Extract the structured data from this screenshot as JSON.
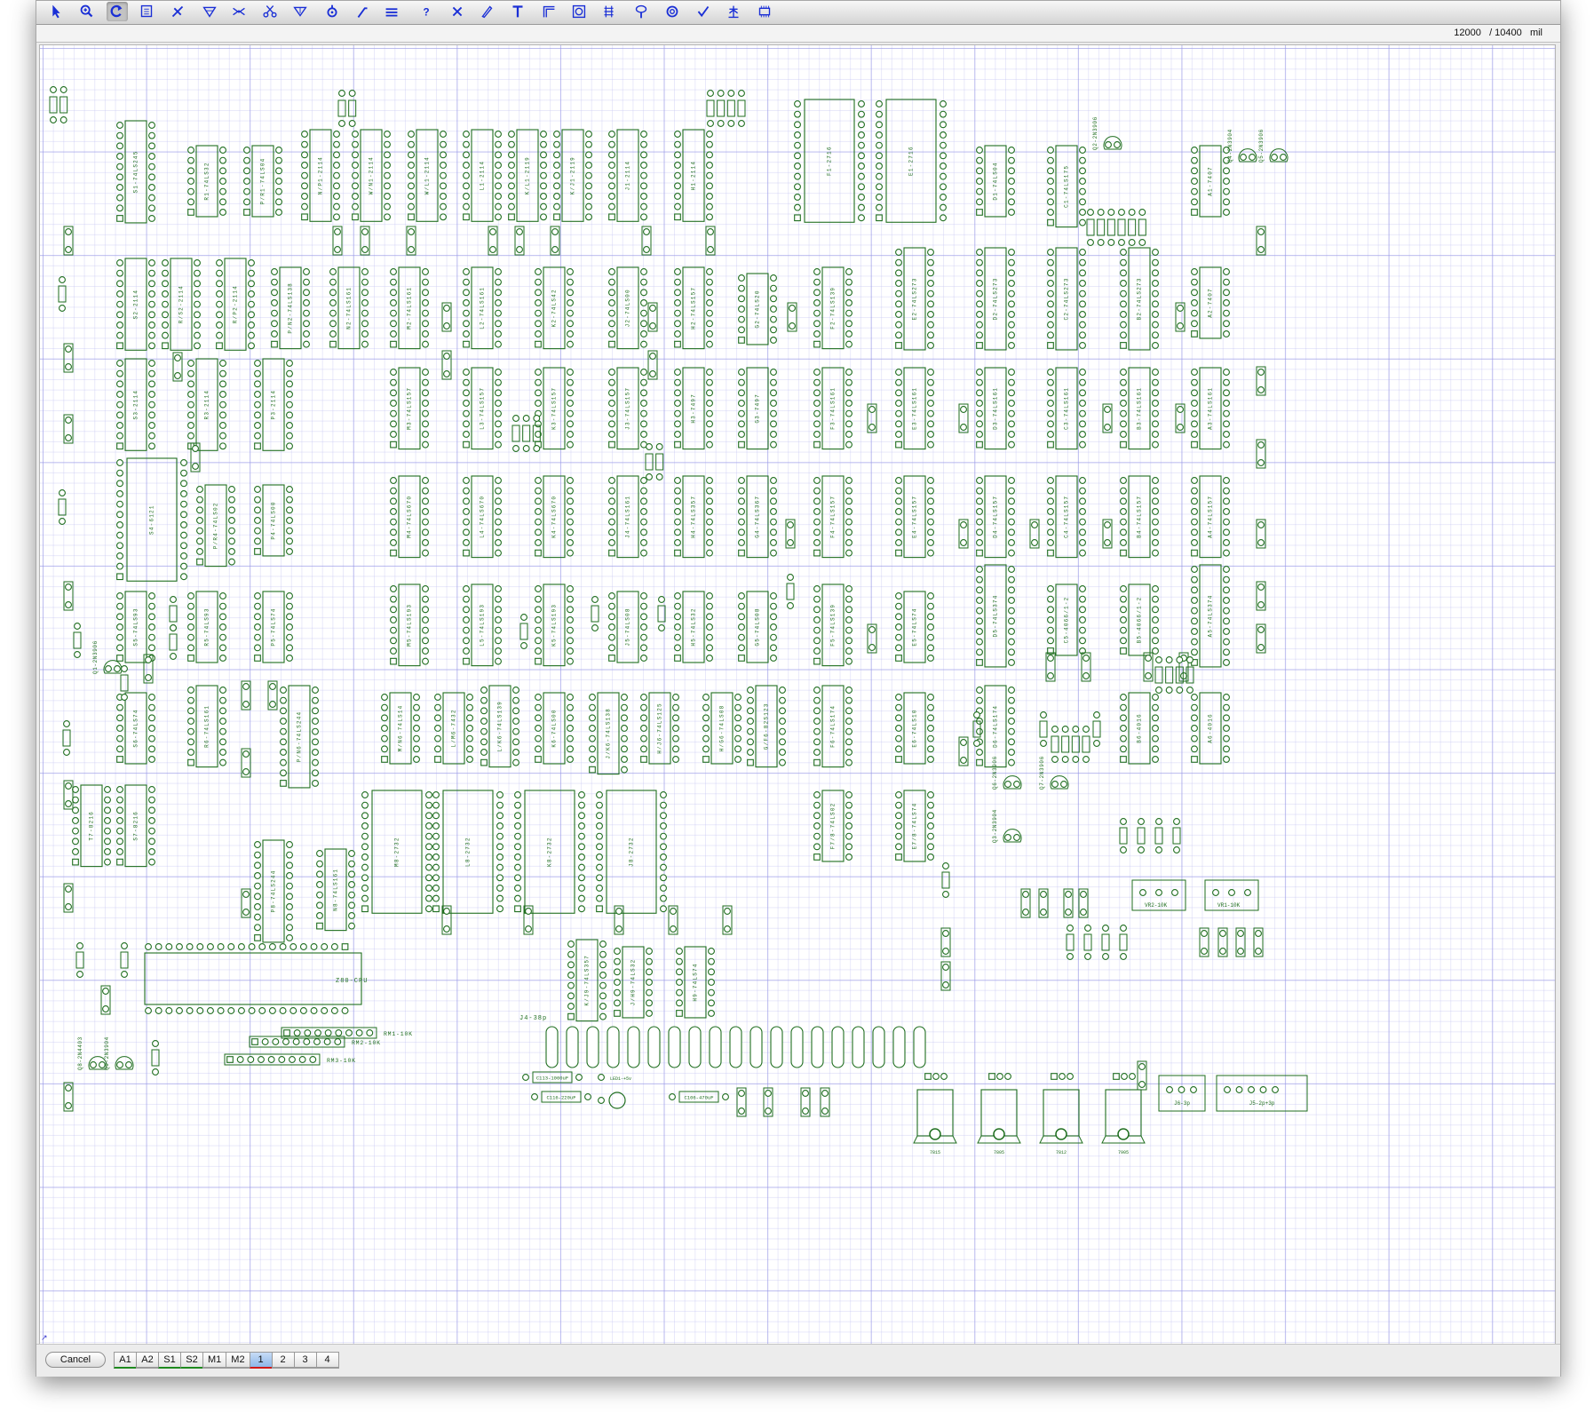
{
  "toolbar": {
    "tools": [
      {
        "name": "pointer-icon",
        "active": false
      },
      {
        "name": "zoom-icon",
        "active": false
      },
      {
        "name": "rotate-icon",
        "active": true
      },
      {
        "name": "place-part-icon",
        "active": false
      },
      {
        "name": "wire-icon",
        "active": false
      },
      {
        "name": "ground-icon",
        "active": false
      },
      {
        "name": "route-icon",
        "active": false
      },
      {
        "name": "cut-icon",
        "active": false
      },
      {
        "name": "down-arrow-icon",
        "active": false
      },
      {
        "name": "via-icon",
        "active": false
      },
      {
        "name": "angle-icon",
        "active": false
      },
      {
        "name": "bus-icon",
        "active": false
      },
      {
        "name": "help-icon",
        "active": false
      },
      {
        "name": "delete-icon",
        "active": false
      },
      {
        "name": "pencil-icon",
        "active": false
      },
      {
        "name": "text-icon",
        "active": false
      },
      {
        "name": "corner-icon",
        "active": false
      },
      {
        "name": "target-icon",
        "active": false
      },
      {
        "name": "align-icon",
        "active": false
      },
      {
        "name": "probe-icon",
        "active": false
      },
      {
        "name": "ring-icon",
        "active": false
      },
      {
        "name": "check-icon",
        "active": false
      },
      {
        "name": "anchor-icon",
        "active": false
      },
      {
        "name": "chip-icon",
        "active": false
      }
    ],
    "accent": "#1a2fd6"
  },
  "coord": {
    "x": "12000",
    "y": "/ 10400",
    "unit": "mil"
  },
  "board": {
    "trace_color": "#1f6e1f",
    "grid_color": "#9a9ae6",
    "chips": [
      [
        "S1-74LS245",
        20
      ],
      [
        "R1-74LS32",
        14
      ],
      [
        "P/R1-74LS04",
        14
      ],
      [
        "N/P1-2114",
        18
      ],
      [
        "W/N1-2114",
        18
      ],
      [
        "W/L1-2114",
        18
      ],
      [
        "L1-2114",
        18
      ],
      [
        "K/L1-2119",
        18
      ],
      [
        "K/J1-2119",
        18
      ],
      [
        "J1-2114",
        18
      ],
      [
        "H1-2114",
        18
      ],
      [
        "F1-2716",
        24
      ],
      [
        "E1-2716",
        24
      ],
      [
        "D1-74LS04",
        14
      ],
      [
        "C1-74LS175",
        16
      ],
      [
        "A1-7407",
        14
      ],
      [
        "S2-2114",
        18
      ],
      [
        "R/S2-2114",
        18
      ],
      [
        "R/P2-2114",
        18
      ],
      [
        "P/N2-74LS138",
        16
      ],
      [
        "N2-74LS161",
        16
      ],
      [
        "M2-74LS161",
        16
      ],
      [
        "L2-74LS161",
        16
      ],
      [
        "K2-74LS42",
        16
      ],
      [
        "J2-74LS00",
        16
      ],
      [
        "H2-74LS157",
        16
      ],
      [
        "G2-74LS20",
        14
      ],
      [
        "F2-74LS139",
        16
      ],
      [
        "E2-74LS273",
        20
      ],
      [
        "D2-74LS273",
        20
      ],
      [
        "C2-74LS273",
        20
      ],
      [
        "B2-74LS273",
        20
      ],
      [
        "A2-7407",
        14
      ],
      [
        "S3-2114",
        18
      ],
      [
        "R3-2114",
        18
      ],
      [
        "P3-2114",
        18
      ],
      [
        "M3-74LS157",
        16
      ],
      [
        "L3-74LS157",
        16
      ],
      [
        "K3-74LS157",
        16
      ],
      [
        "J3-74LS157",
        16
      ],
      [
        "H3-7497",
        16
      ],
      [
        "G3-7497",
        16
      ],
      [
        "F3-74LS161",
        16
      ],
      [
        "E3-74LS161",
        16
      ],
      [
        "D3-74LS161",
        16
      ],
      [
        "C3-74LS161",
        16
      ],
      [
        "B3-74LS161",
        16
      ],
      [
        "A3-74LS161",
        16
      ],
      [
        "S4-6121",
        24
      ],
      [
        "P/R4-74LS02",
        16
      ],
      [
        "P4-74LS00",
        14
      ],
      [
        "M4-74LS670",
        16
      ],
      [
        "L4-74LS670",
        16
      ],
      [
        "K4-74LS670",
        16
      ],
      [
        "J4-74LS161",
        16
      ],
      [
        "H4-74LS357",
        16
      ],
      [
        "G4-74LS367",
        16
      ],
      [
        "F4-74LS157",
        16
      ],
      [
        "E4-74LS157",
        16
      ],
      [
        "D4-74LS157",
        16
      ],
      [
        "C4-74LS157",
        16
      ],
      [
        "B4-74LS157",
        16
      ],
      [
        "A4-74LS157",
        16
      ],
      [
        "S5-74LS93",
        14
      ],
      [
        "R5-74LS93",
        14
      ],
      [
        "P5-74LS74",
        14
      ],
      [
        "M5-74LS193",
        16
      ],
      [
        "L5-74LS193",
        16
      ],
      [
        "K5-74LS193",
        16
      ],
      [
        "J5-74LS08",
        14
      ],
      [
        "H5-74LS32",
        14
      ],
      [
        "G5-74LS08",
        14
      ],
      [
        "F5-74LS139",
        16
      ],
      [
        "E5-74LS74",
        14
      ],
      [
        "D5-74LS374",
        20
      ],
      [
        "C5-4066/1-2",
        14
      ],
      [
        "B5-4066/1-2",
        14
      ],
      [
        "A5-74LS374",
        20
      ],
      [
        "S6-74LS74",
        14
      ],
      [
        "R6-74LS161",
        16
      ],
      [
        "P/N6-74LS244",
        20
      ],
      [
        "M/N6-74LS14",
        14
      ],
      [
        "L/M6-7432",
        14
      ],
      [
        "L/K6-74LS139",
        16
      ],
      [
        "K6-74LS00",
        14
      ],
      [
        "J/K6-74LS138",
        16
      ],
      [
        "H/J6-74LS125",
        14
      ],
      [
        "H/G6-74LS08",
        14
      ],
      [
        "G/F6-82S123",
        16
      ],
      [
        "F6-74LS174",
        16
      ],
      [
        "E6-74LS10",
        14
      ],
      [
        "D6-74LS174",
        16
      ],
      [
        "B6-4016",
        14
      ],
      [
        "A6-4016",
        14
      ],
      [
        "T7-8216",
        16
      ],
      [
        "S7-8216",
        16
      ],
      [
        "M8-2732",
        24
      ],
      [
        "L8-2732",
        24
      ],
      [
        "K8-2732",
        24
      ],
      [
        "J8-2732",
        24
      ],
      [
        "F7/8-74LS02",
        14
      ],
      [
        "E7/8-74LS74",
        14
      ],
      [
        "P8-74LS244",
        20
      ],
      [
        "N8-74LS161",
        16
      ],
      [
        "K/J9-74LS357",
        16
      ],
      [
        "J/H9-74LS32",
        14
      ],
      [
        "H9-74LS74",
        14
      ]
    ],
    "misc_labels": [
      "Z80-CPU",
      "J4-38p",
      "RM1-10K",
      "RM2-10K",
      "RM3-10K",
      "VR2-10K",
      "VR1-10K",
      "J6-3p",
      "J5-2p+3p",
      "C113-1000uF",
      "C116-220uF",
      "C106-470uF",
      "LED1-+5v"
    ],
    "transistor_labels": [
      "Q1-2N3906",
      "Q2-2N3906",
      "Q3-2N3904",
      "Q4-2N3904",
      "Q5-2N3906",
      "Q6-2N3906",
      "Q7-2N3906",
      "Q8-2N4403",
      "Q9-2N3904"
    ],
    "regulators": [
      "7815",
      "7805",
      "7812",
      "7905"
    ]
  },
  "status": {
    "cancel_label": "Cancel",
    "tabs": [
      {
        "label": "A1",
        "selected": false
      },
      {
        "label": "A2",
        "selected": false
      },
      {
        "label": "S1",
        "selected": false
      },
      {
        "label": "S2",
        "selected": false
      },
      {
        "label": "M1",
        "selected": false
      },
      {
        "label": "M2",
        "selected": false
      },
      {
        "label": "1",
        "selected": true
      },
      {
        "label": "2",
        "selected": false
      },
      {
        "label": "3",
        "selected": false
      },
      {
        "label": "4",
        "selected": false
      }
    ]
  }
}
